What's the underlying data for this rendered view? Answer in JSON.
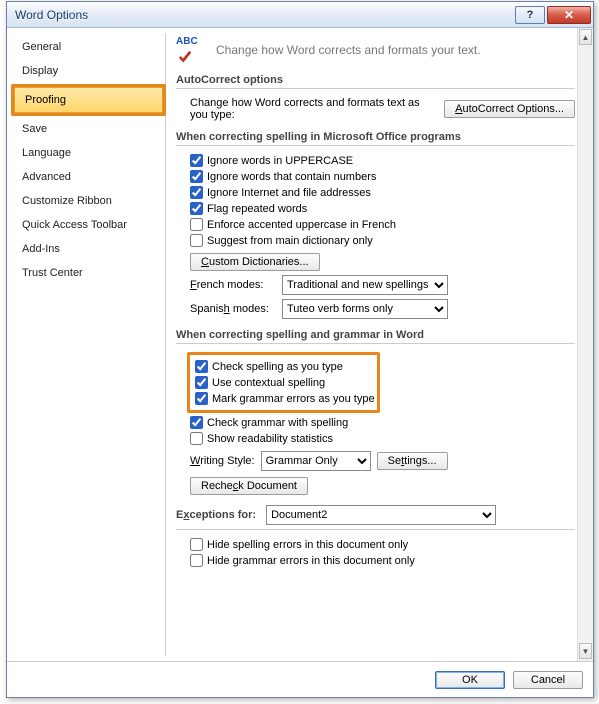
{
  "window": {
    "title": "Word Options",
    "help_label": "?",
    "close_label": "✕"
  },
  "sidebar": {
    "items": [
      {
        "label": "General"
      },
      {
        "label": "Display"
      },
      {
        "label": "Proofing",
        "selected": true
      },
      {
        "label": "Save"
      },
      {
        "label": "Language"
      },
      {
        "label": "Advanced"
      },
      {
        "label": "Customize Ribbon"
      },
      {
        "label": "Quick Access Toolbar"
      },
      {
        "label": "Add-Ins"
      },
      {
        "label": "Trust Center"
      }
    ]
  },
  "header": {
    "abc_text": "ABC",
    "text": "Change how Word corrects and formats your text."
  },
  "autocorrect": {
    "title": "AutoCorrect options",
    "desc": "Change how Word corrects and formats text as you type:",
    "button": "AutoCorrect Options..."
  },
  "spelling_office": {
    "title": "When correcting spelling in Microsoft Office programs",
    "opts": [
      {
        "label": "Ignore words in UPPERCASE",
        "checked": true
      },
      {
        "label": "Ignore words that contain numbers",
        "checked": true
      },
      {
        "label": "Ignore Internet and file addresses",
        "checked": true
      },
      {
        "label": "Flag repeated words",
        "checked": true
      },
      {
        "label": "Enforce accented uppercase in French",
        "checked": false
      },
      {
        "label": "Suggest from main dictionary only",
        "checked": false
      }
    ],
    "custom_dict_btn": "Custom Dictionaries...",
    "french_label": "French modes:",
    "french_value": "Traditional and new spellings",
    "spanish_label": "Spanish modes:",
    "spanish_value": "Tuteo verb forms only"
  },
  "spelling_word": {
    "title": "When correcting spelling and grammar in Word",
    "hl": [
      {
        "label": "Check spelling as you type",
        "checked": true
      },
      {
        "label": "Use contextual spelling",
        "checked": true
      },
      {
        "label": "Mark grammar errors as you type",
        "checked": true
      }
    ],
    "rest": [
      {
        "label": "Check grammar with spelling",
        "checked": true
      },
      {
        "label": "Show readability statistics",
        "checked": false
      }
    ],
    "ws_label": "Writing Style:",
    "ws_value": "Grammar Only",
    "settings_btn": "Settings...",
    "recheck_btn": "Recheck Document"
  },
  "exceptions": {
    "label": "Exceptions for:",
    "doc": "Document2",
    "opts": [
      {
        "label": "Hide spelling errors in this document only",
        "checked": false
      },
      {
        "label": "Hide grammar errors in this document only",
        "checked": false
      }
    ]
  },
  "footer": {
    "ok": "OK",
    "cancel": "Cancel"
  }
}
